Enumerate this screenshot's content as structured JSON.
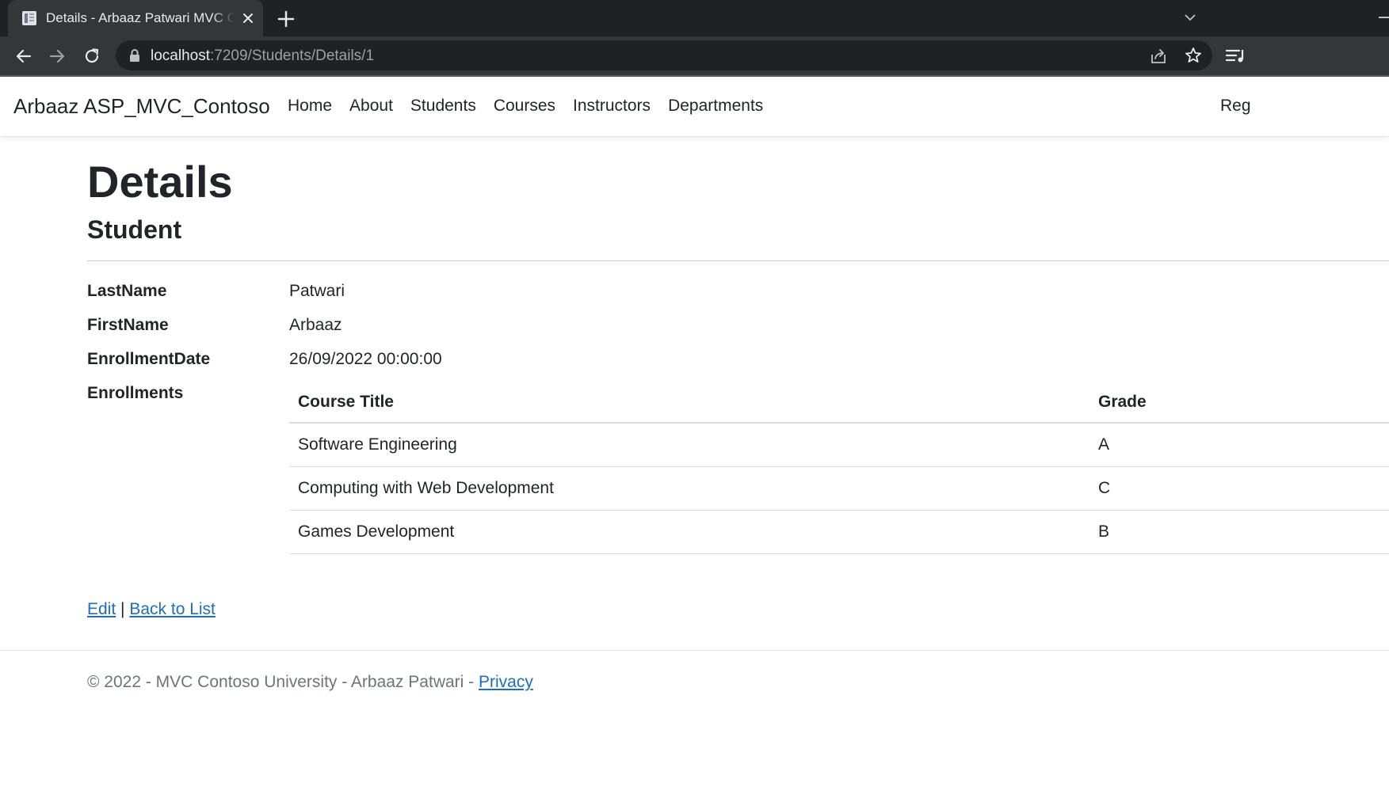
{
  "browser": {
    "tab_title": "Details - Arbaaz Patwari MVC Contoso",
    "url_host": "localhost",
    "url_rest": ":7209/Students/Details/1"
  },
  "navbar": {
    "brand": "Arbaaz ASP_MVC_Contoso",
    "links": [
      "Home",
      "About",
      "Students",
      "Courses",
      "Instructors",
      "Departments"
    ],
    "right_link": "Reg"
  },
  "page": {
    "title": "Details",
    "subtitle": "Student",
    "fields": [
      {
        "label": "LastName",
        "value": "Patwari"
      },
      {
        "label": "FirstName",
        "value": "Arbaaz"
      },
      {
        "label": "EnrollmentDate",
        "value": "26/09/2022 00:00:00"
      },
      {
        "label": "Enrollments"
      }
    ],
    "enrollments": {
      "headers": [
        "Course Title",
        "Grade"
      ],
      "rows": [
        {
          "course": "Software Engineering",
          "grade": "A"
        },
        {
          "course": "Computing with Web Development",
          "grade": "C"
        },
        {
          "course": "Games Development",
          "grade": "B"
        }
      ]
    },
    "actions": {
      "edit": "Edit",
      "separator": "|",
      "back": "Back to List"
    }
  },
  "footer": {
    "text": "© 2022 - MVC Contoso University - Arbaaz Patwari - ",
    "privacy": "Privacy"
  }
}
